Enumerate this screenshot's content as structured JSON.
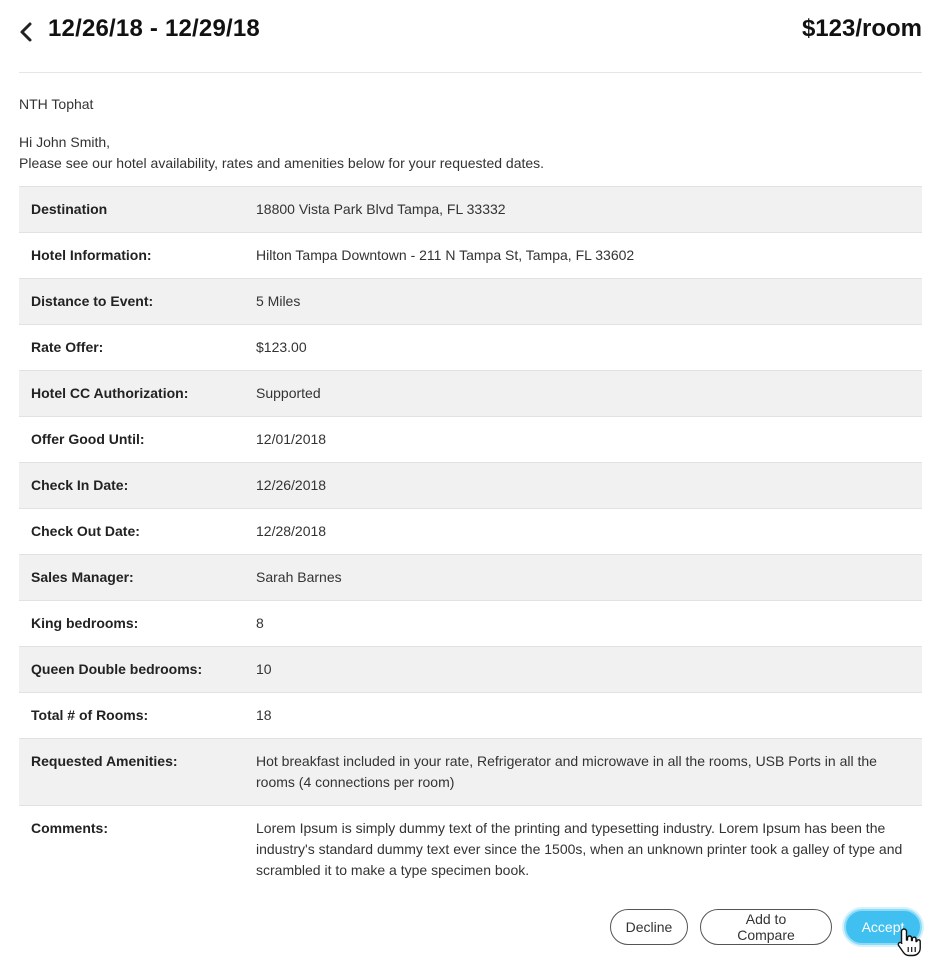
{
  "header": {
    "dates": "12/26/18 - 12/29/18",
    "price": "$123/room"
  },
  "from": "NTH Tophat",
  "greeting": {
    "line1": "Hi John Smith,",
    "line2": "Please see our hotel availability, rates and amenities below for your requested dates."
  },
  "details": [
    {
      "label": "Destination",
      "value": "18800 Vista Park Blvd Tampa, FL 33332"
    },
    {
      "label": "Hotel Information:",
      "value": "Hilton Tampa Downtown - 211 N Tampa St, Tampa, FL 33602"
    },
    {
      "label": "Distance to Event:",
      "value": "5 Miles"
    },
    {
      "label": "Rate Offer:",
      "value": "$123.00"
    },
    {
      "label": "Hotel CC Authorization:",
      "value": "Supported"
    },
    {
      "label": "Offer Good Until:",
      "value": "12/01/2018"
    },
    {
      "label": "Check In Date:",
      "value": "12/26/2018"
    },
    {
      "label": "Check Out Date:",
      "value": "12/28/2018"
    },
    {
      "label": "Sales Manager:",
      "value": "Sarah Barnes"
    },
    {
      "label": "King bedrooms:",
      "value": "8"
    },
    {
      "label": "Queen Double bedrooms:",
      "value": "10"
    },
    {
      "label": "Total # of Rooms:",
      "value": "18"
    },
    {
      "label": "Requested Amenities:",
      "value": "Hot breakfast included in your rate, Refrigerator and microwave in all the rooms, USB Ports in all the rooms (4 connections per room)"
    },
    {
      "label": "Comments:",
      "value": "Lorem Ipsum is simply dummy text of the printing and typesetting industry. Lorem Ipsum has been the industry's standard dummy text ever since the 1500s, when an unknown printer took a galley of type and scrambled it to make a type specimen book."
    }
  ],
  "actions": {
    "decline_label": "Decline",
    "compare_label": "Add to Compare",
    "accept_label": "Accept"
  },
  "colors": {
    "accent": "#3fc0f0",
    "row_alt": "#f1f1f1"
  },
  "icons": {
    "back": "chevron-left-icon",
    "cursor": "hand-pointer-icon"
  }
}
